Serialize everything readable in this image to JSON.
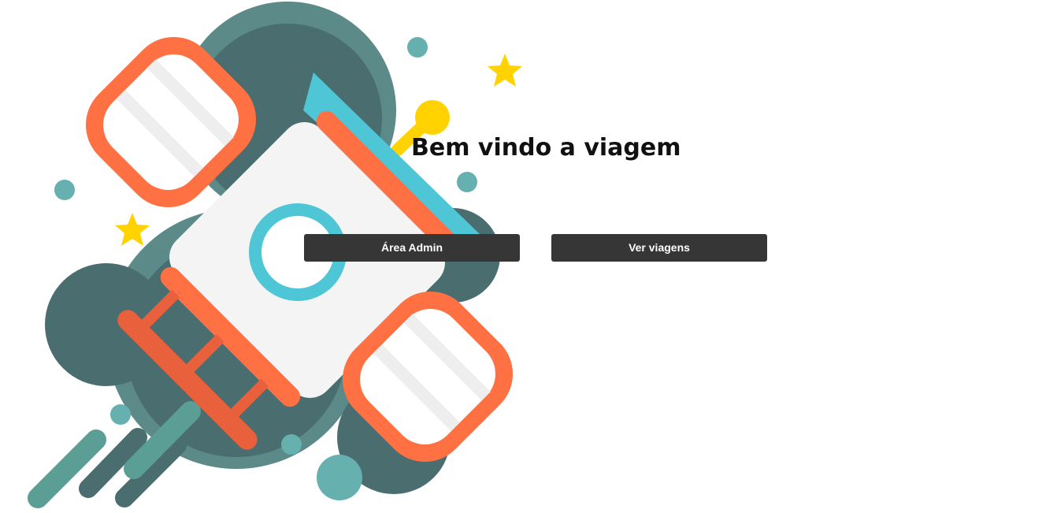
{
  "main": {
    "title": "Bem vindo a viagem",
    "buttons": {
      "admin_label": "Área Admin",
      "trips_label": "Ver viagens"
    }
  },
  "illustration": {
    "name": "rocket-illustration",
    "colors": {
      "dark_teal": "#4a6e70",
      "mid_teal": "#5b8a88",
      "light_teal": "#66b0b0",
      "orange": "#ff7043",
      "dark_orange": "#e8603c",
      "cyan": "#4fc6d6",
      "white": "#f4f4f4",
      "yellow": "#ffd200",
      "button_bg": "#363636"
    }
  }
}
